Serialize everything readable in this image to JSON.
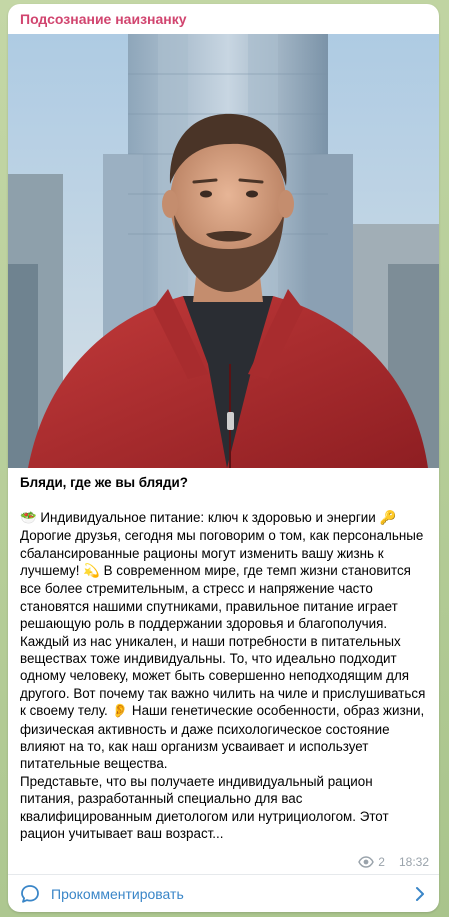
{
  "channel": {
    "name": "Подсознание наизнанку"
  },
  "post": {
    "title": "Бляди, где же вы бляди?",
    "p1_emoji_start": "🥗",
    "p1_text": " Индивидуальное питание: ключ к здоровью и энергии ",
    "p1_emoji_end": "🔑",
    "p2_text_a": "Дорогие друзья, сегодня мы поговорим о том, как персональные сбалансированные рационы могут изменить вашу жизнь к лучшему! ",
    "p2_emoji": "💫",
    "p2_text_b": " В современном мире, где темп жизни становится все более стремительным, а стресс и напряжение часто становятся нашими спутниками, правильное питание играет решающую роль в поддержании здоровья и благополучия.",
    "p3_text_a": "Каждый из нас уникален, и наши потребности в питательных веществах тоже индивидуальны. То, что идеально подходит одному человеку, может быть совершенно неподходящим для другого. Вот почему так важно чилить на чиле и прислушиваться к своему телу. ",
    "p3_emoji": "👂",
    "p3_text_b": " Наши генетические особенности, образ жизни, физическая активность и даже психологическое состояние влияют на то, как наш организм усваивает и использует питательные вещества.",
    "p4_text": "Представьте, что вы получаете индивидуальный рацион питания, разработанный специально для вас квалифицированным диетологом или нутрициологом. Этот рацион учитывает ваш возраст..."
  },
  "meta": {
    "views": "2",
    "time": "18:32",
    "views_icon": "eye-icon"
  },
  "comments": {
    "label": "Прокомментировать",
    "icon": "comment-bubble-icon",
    "chevron": "chevron-right-icon"
  },
  "colors": {
    "channel_name": "#d1456f",
    "link": "#3a86c8",
    "meta": "#9aa3ab"
  }
}
